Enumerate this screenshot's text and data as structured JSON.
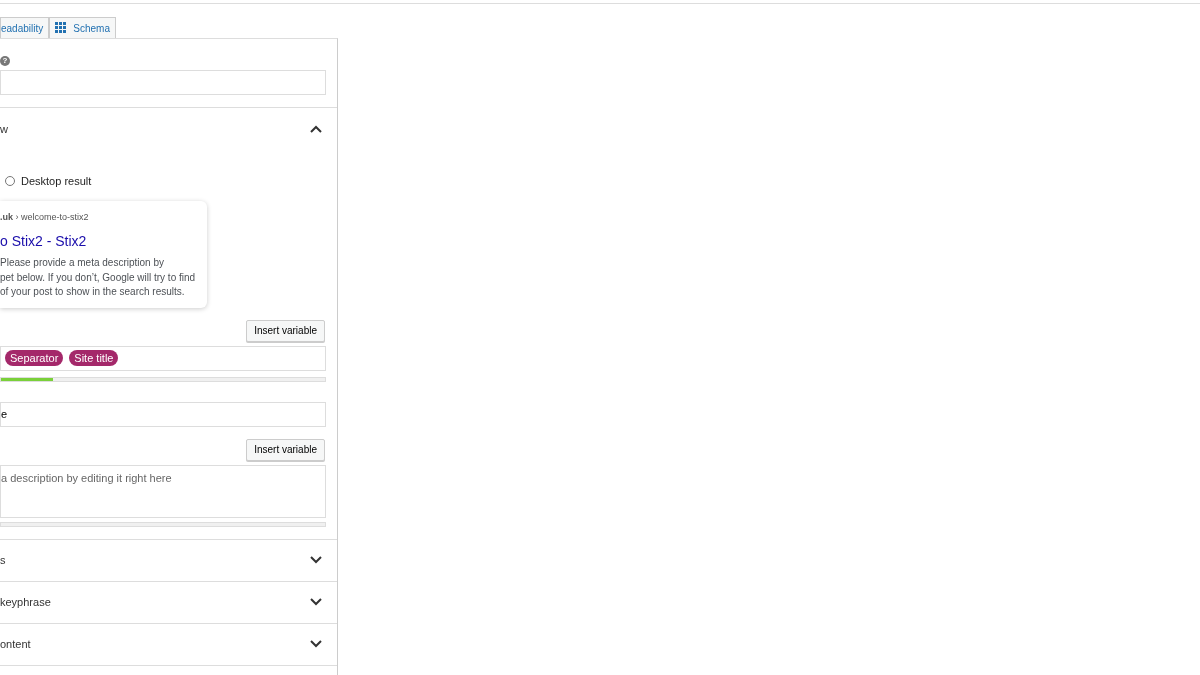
{
  "tabs": [
    {
      "label": "eadability",
      "kind": "plain"
    },
    {
      "label": "Schema",
      "kind": "schema"
    }
  ],
  "focus": {
    "help": "?"
  },
  "snippet": {
    "heading": "w",
    "expanded": true,
    "modes": [
      {
        "label": "Desktop result",
        "selected": false
      }
    ],
    "preview": {
      "breadcrumb": "**.uk** › welcome-to-stix2",
      "title": "o Stix2 - Stix2",
      "description": "Please provide a meta description by\npet below. If you don’t, Google will try to find\nof your post to show in the search results."
    },
    "title_field": {
      "button": "Insert variable",
      "pills": [
        "Separator",
        "Site title"
      ],
      "level": 0.16
    },
    "slug_field": {
      "value": "e"
    },
    "description_field": {
      "button": "Insert variable",
      "placeholder": "a description by editing it right here",
      "level": 0
    }
  },
  "sections": [
    {
      "label": "s",
      "expanded": false
    },
    {
      "label": "keyphrase",
      "expanded": false
    },
    {
      "label": "ontent",
      "expanded": false
    }
  ]
}
